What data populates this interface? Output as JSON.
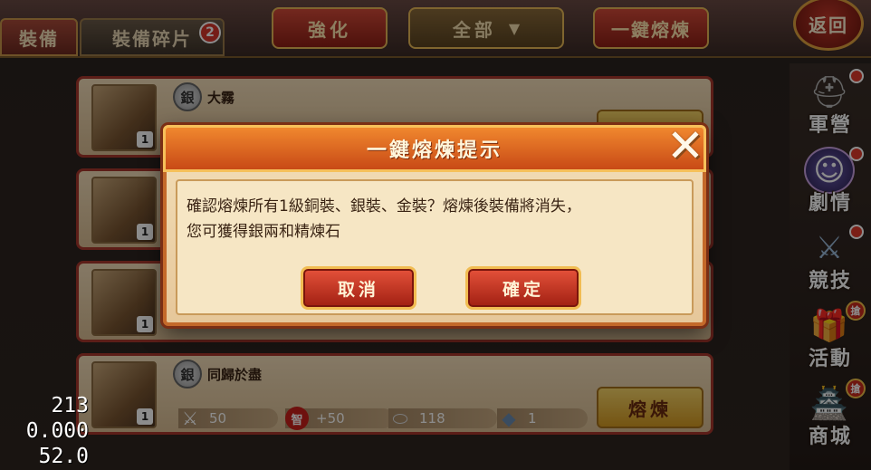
{
  "tabs": {
    "equip_label": "裝備",
    "fragments_label": "裝備碎片",
    "fragments_badge": "2"
  },
  "toolbar": {
    "strengthen_label": "強化",
    "filter_label": "全部",
    "one_key_smelt_label": "一鍵熔煉",
    "back_label": "返回"
  },
  "items": [
    {
      "name": "大霧",
      "grade": "銀",
      "qty": "1"
    },
    {
      "name": "",
      "grade": "",
      "qty": "1"
    },
    {
      "name": "",
      "grade": "",
      "qty": "1"
    },
    {
      "name": "同歸於盡",
      "grade": "銀",
      "qty": "1",
      "attack": "50",
      "intel_bonus": "+50",
      "silver": "118",
      "stone": "1",
      "smelt_label": "熔煉"
    }
  ],
  "first_item_smelt_label": "熔煉",
  "intel_icon_text": "智",
  "sidebar": {
    "items": [
      {
        "label": "軍營",
        "icon": "helmet-icon"
      },
      {
        "label": "劇情",
        "icon": "portrait-icon"
      },
      {
        "label": "競技",
        "icon": "crossed-swords-icon"
      },
      {
        "label": "活動",
        "icon": "gift-bag-icon",
        "tag": "搶"
      },
      {
        "label": "商城",
        "icon": "shop-icon",
        "tag": "搶"
      }
    ]
  },
  "debug": {
    "line1": "213",
    "line2": "0.000",
    "line3": "52.0"
  },
  "dialog": {
    "title": "一鍵熔煉提示",
    "message_line1": "確認熔煉所有1級銅裝、銀裝、金裝？熔煉後裝備將消失，",
    "message_line2": "您可獲得銀兩和精煉石",
    "cancel_label": "取消",
    "confirm_label": "確定"
  },
  "colors": {
    "button_red": "#c2382a",
    "button_gold": "#e8b957",
    "dialog_header": "#e06a22"
  }
}
